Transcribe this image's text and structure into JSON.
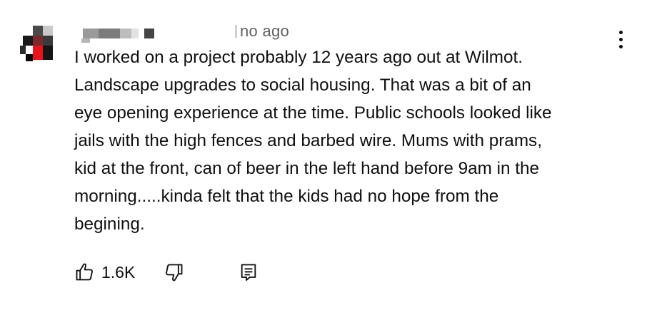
{
  "comment": {
    "timestamp": "no ago",
    "text": "I worked on a project probably 12 years ago out at Wilmot.\nLandscape upgrades to social housing. That was a bit of an\neye opening experience at the time. Public schools looked like\njails with the high fences and barbed wire. Mums with prams,\nkid at the front, can of beer in the left hand before 9am in the\nmorning.....kinda felt that the kids had no hope from the\nbegining.",
    "like_count": "1.6K"
  },
  "icons": {
    "menu": "vertical-ellipsis-icon",
    "like": "thumbs-up-icon",
    "dislike": "thumbs-down-icon",
    "reply": "comment-reply-icon"
  },
  "colors": {
    "text": "#0f0f0f",
    "secondary_text": "#606060",
    "avatar_accent": "#e8141c"
  }
}
